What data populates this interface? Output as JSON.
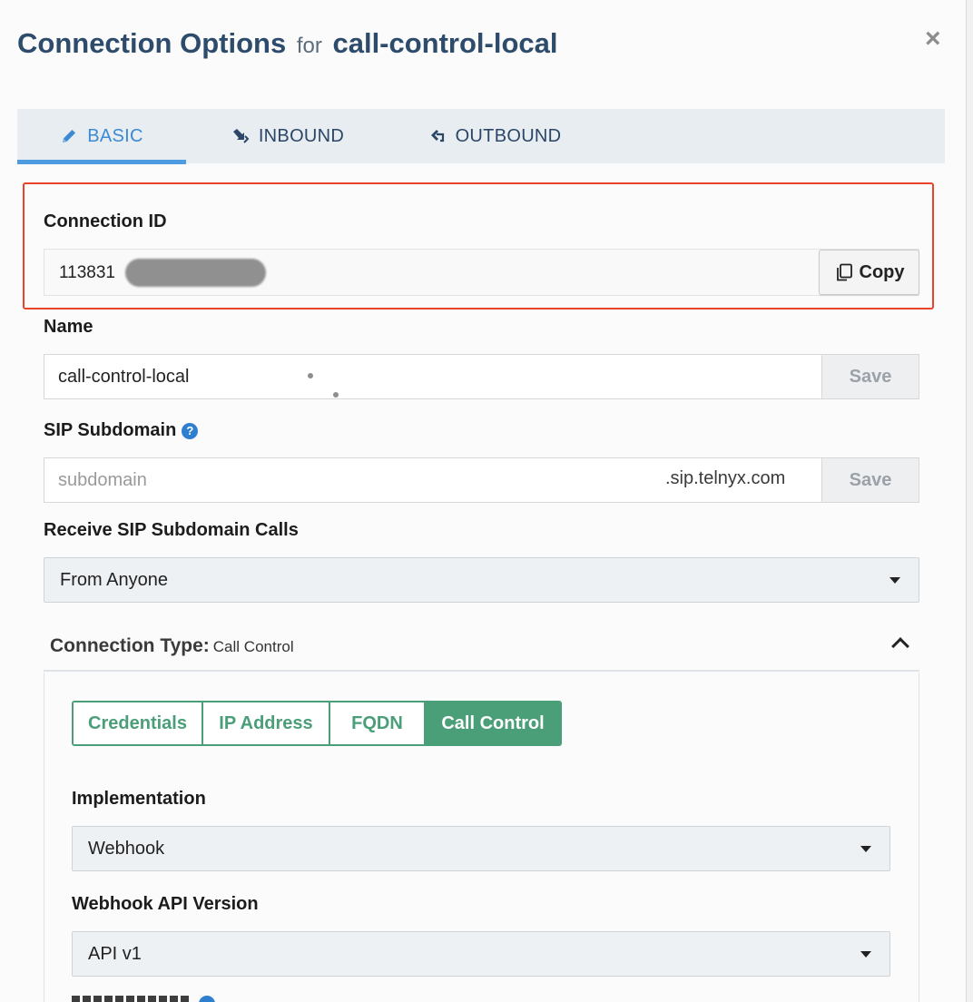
{
  "modal": {
    "title": "Connection Options",
    "title_for": "for",
    "connection_name": "call-control-local",
    "close_glyph": "×"
  },
  "tabs": [
    {
      "label": "BASIC",
      "icon": "pencil-icon",
      "active": true
    },
    {
      "label": "INBOUND",
      "icon": "inbound-arrow-icon",
      "active": false
    },
    {
      "label": "OUTBOUND",
      "icon": "outbound-arrow-icon",
      "active": false
    }
  ],
  "connection_id": {
    "label": "Connection ID",
    "value_visible": "113831",
    "copy_label": "Copy"
  },
  "name": {
    "label": "Name",
    "value": "call-control-local",
    "save_label": "Save"
  },
  "sip_subdomain": {
    "label": "SIP Subdomain",
    "placeholder": "subdomain",
    "suffix": ".sip.telnyx.com",
    "save_label": "Save",
    "help": "?"
  },
  "receive_calls": {
    "label": "Receive SIP Subdomain Calls",
    "selected": "From Anyone"
  },
  "connection_type": {
    "label": "Connection Type:",
    "value": "Call Control",
    "options": [
      "Credentials",
      "IP Address",
      "FQDN",
      "Call Control"
    ],
    "active_index": 3
  },
  "implementation": {
    "label": "Implementation",
    "selected": "Webhook"
  },
  "webhook_api_version": {
    "label": "Webhook API Version",
    "selected": "API v1"
  },
  "colors": {
    "title": "#2d4b6b",
    "tab_active": "#3b8ad3",
    "highlight": "#e8442c",
    "segment_green": "#4a9e78"
  }
}
